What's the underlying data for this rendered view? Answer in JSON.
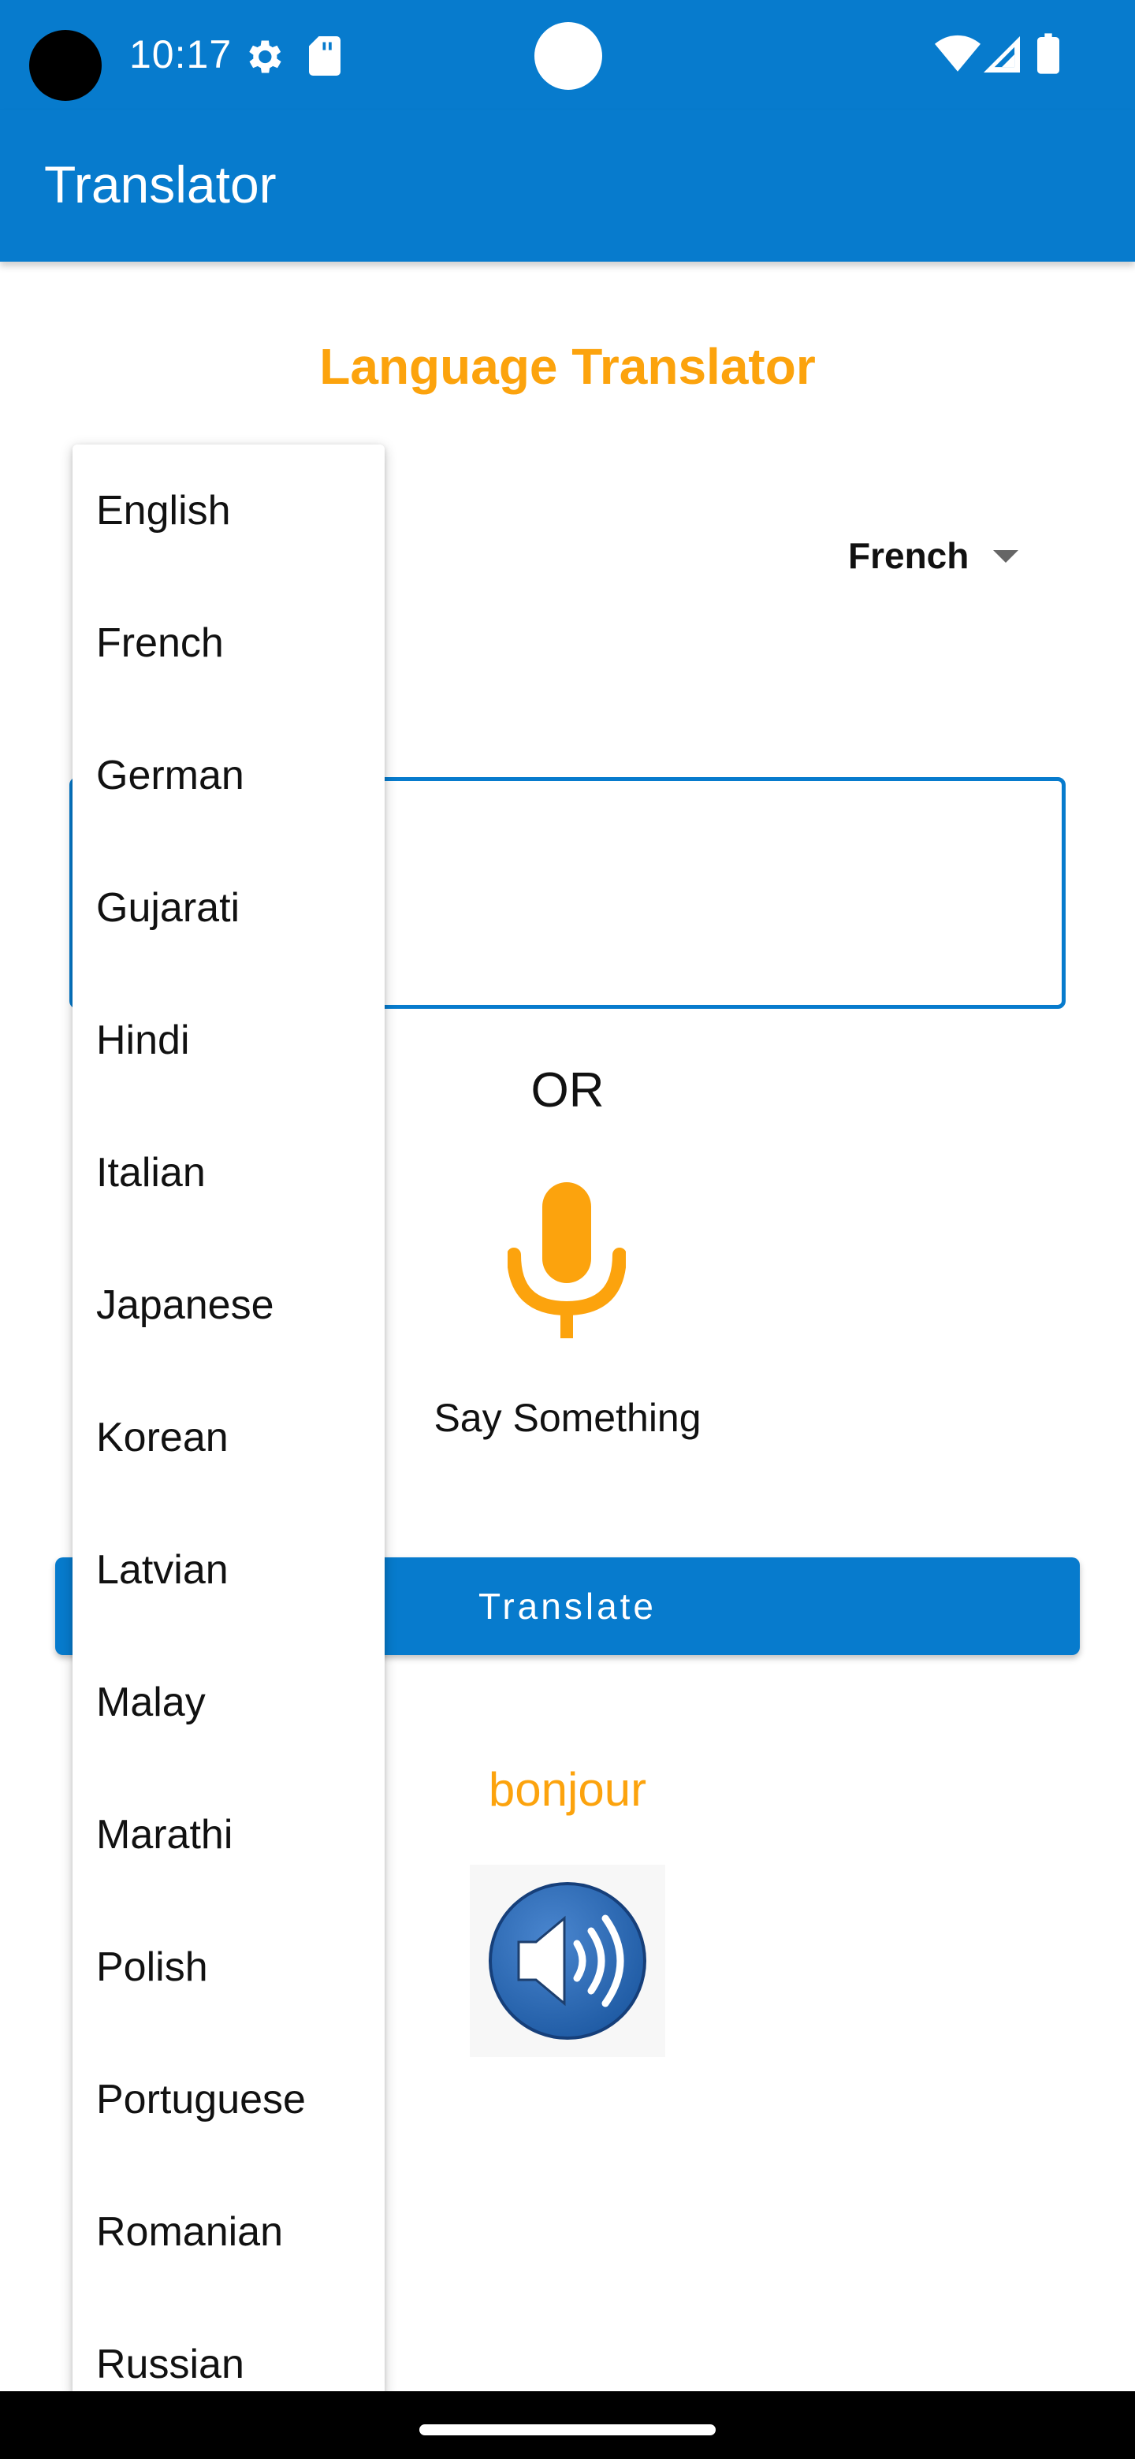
{
  "status_bar": {
    "time": "10:17",
    "icons": [
      "gear-icon",
      "sd-card-icon",
      "wifi-icon",
      "cell-signal-icon",
      "battery-icon"
    ]
  },
  "app_bar": {
    "title": "Translator"
  },
  "main": {
    "heading": "Language Translator",
    "target_language": "French",
    "or_label": "OR",
    "say_label": "Say Something",
    "translate_label": "Translate",
    "result": "bonjour"
  },
  "dropdown": {
    "items": [
      "English",
      "French",
      "German",
      "Gujarati",
      "Hindi",
      "Italian",
      "Japanese",
      "Korean",
      "Latvian",
      "Malay",
      "Marathi",
      "Polish",
      "Portuguese",
      "Romanian",
      "Russian"
    ]
  },
  "colors": {
    "primary": "#077bcd",
    "accent": "#fca30d",
    "speaker": "#2e6db5"
  }
}
